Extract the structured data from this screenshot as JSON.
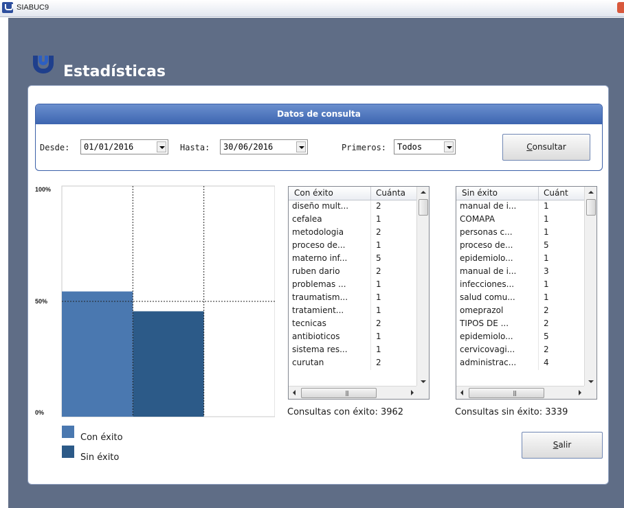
{
  "window": {
    "title": "SIABUC9"
  },
  "header": {
    "title": "Estadísticas"
  },
  "query": {
    "group_title": "Datos de consulta",
    "desde_label": "Desde:",
    "desde_value": "01/01/2016",
    "hasta_label": "Hasta:",
    "hasta_value": "30/06/2016",
    "primeros_label": "Primeros:",
    "primeros_value": "Todos",
    "consultar_mnemonic": "C",
    "consultar_rest": "onsultar"
  },
  "chart_data": {
    "type": "bar",
    "categories": [
      "Con éxito",
      "Sin éxito"
    ],
    "values": [
      3962,
      3339
    ],
    "series": [
      {
        "name": "Con éxito",
        "values": [
          3962
        ],
        "color": "#4a78b0"
      },
      {
        "name": "Sin éxito",
        "values": [
          3339
        ],
        "color": "#2c5a88"
      }
    ],
    "percent_values": [
      54.3,
      45.7
    ],
    "yticks": [
      "100%",
      "50%",
      "0%"
    ],
    "ylim": [
      0,
      100
    ],
    "legend_position": "bottom-left",
    "grid": "dashed"
  },
  "legend": [
    {
      "label": "Con éxito",
      "color": "#4a78b0"
    },
    {
      "label": "Sin éxito",
      "color": "#2c5a88"
    }
  ],
  "success_list": {
    "col1": "Con éxito",
    "col2": "Cuánta",
    "rows": [
      [
        "diseño mult...",
        "2"
      ],
      [
        "cefalea",
        "1"
      ],
      [
        "metodologia",
        "2"
      ],
      [
        "proceso de...",
        "1"
      ],
      [
        "materno inf...",
        "5"
      ],
      [
        "ruben dario",
        "2"
      ],
      [
        "problemas ...",
        "1"
      ],
      [
        "traumatism...",
        "1"
      ],
      [
        "tratamient...",
        "1"
      ],
      [
        "tecnicas",
        "2"
      ],
      [
        "antibioticos",
        "1"
      ],
      [
        "sistema res...",
        "1"
      ],
      [
        "curutan",
        "2"
      ]
    ],
    "total": "Consultas con éxito: 3962"
  },
  "fail_list": {
    "col1": "Sin éxito",
    "col2": "Cuánt",
    "rows": [
      [
        "manual de i...",
        "1"
      ],
      [
        "COMAPA",
        "1"
      ],
      [
        "personas c...",
        "1"
      ],
      [
        "proceso de...",
        "5"
      ],
      [
        "epidemiolo...",
        "1"
      ],
      [
        "manual de i...",
        "3"
      ],
      [
        "infecciones...",
        "1"
      ],
      [
        "salud comu...",
        "1"
      ],
      [
        "omeprazol",
        "2"
      ],
      [
        "TIPOS DE ...",
        "2"
      ],
      [
        "epidemiolo...",
        "5"
      ],
      [
        "cervicovagi...",
        "2"
      ],
      [
        "administrac...",
        "4"
      ]
    ],
    "total": "Consultas sin éxito: 3339"
  },
  "salir": {
    "mnemonic": "S",
    "rest": "alir"
  }
}
